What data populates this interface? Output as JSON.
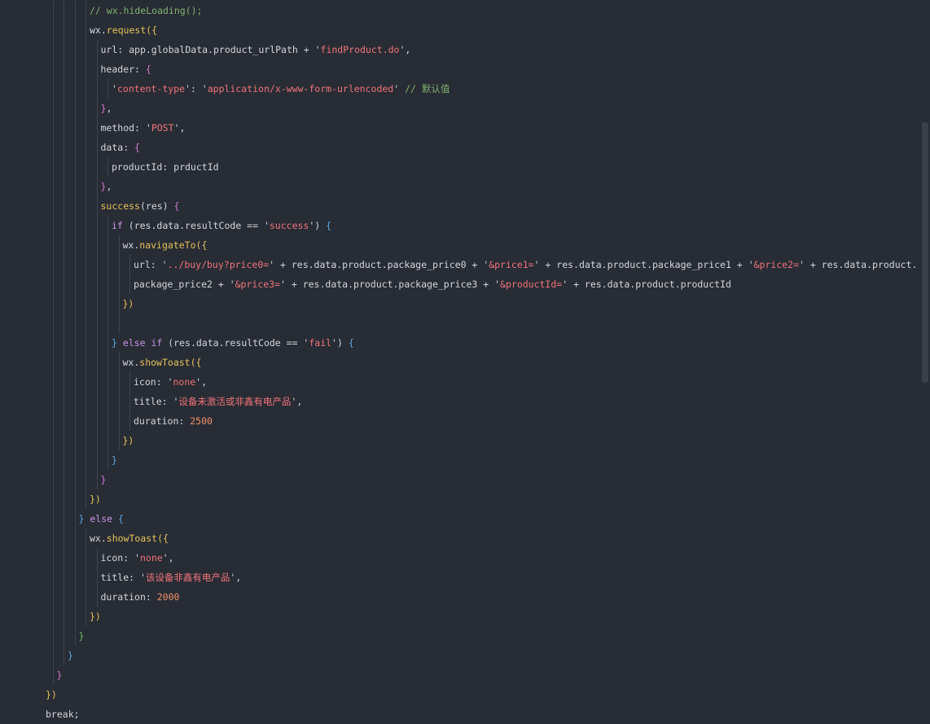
{
  "editor": {
    "language": "javascript",
    "colors": {
      "background": "#282c34",
      "comment": "#7fb36f",
      "string": "#f0737b",
      "number": "#f0916a",
      "function": "#e6c35c",
      "keyword": "#c994e8"
    },
    "lines": [
      {
        "indent": 8,
        "tokens": [
          [
            "// wx.hideLoading();",
            "comment"
          ]
        ]
      },
      {
        "indent": 8,
        "tokens": [
          [
            "wx.",
            "default"
          ],
          [
            "request",
            "fn"
          ],
          [
            "({",
            "bracket-y"
          ]
        ]
      },
      {
        "indent": 10,
        "tokens": [
          [
            "url: app.globalData.product_urlPath + '",
            "default"
          ],
          [
            "findProduct.do",
            "string"
          ],
          [
            "',",
            "default"
          ]
        ]
      },
      {
        "indent": 10,
        "tokens": [
          [
            "header: ",
            "default"
          ],
          [
            "{",
            "bracket-p"
          ]
        ]
      },
      {
        "indent": 12,
        "tokens": [
          [
            "'",
            "default"
          ],
          [
            "content-type",
            "string"
          ],
          [
            "': '",
            "default"
          ],
          [
            "application/x-www-form-urlencoded",
            "string"
          ],
          [
            "' ",
            "default"
          ],
          [
            "// 默认值",
            "comment"
          ]
        ]
      },
      {
        "indent": 10,
        "tokens": [
          [
            "}",
            "bracket-p"
          ],
          [
            ",",
            "default"
          ]
        ]
      },
      {
        "indent": 10,
        "tokens": [
          [
            "method: '",
            "default"
          ],
          [
            "POST",
            "string"
          ],
          [
            "',",
            "default"
          ]
        ]
      },
      {
        "indent": 10,
        "tokens": [
          [
            "data: ",
            "default"
          ],
          [
            "{",
            "bracket-p"
          ]
        ]
      },
      {
        "indent": 12,
        "tokens": [
          [
            "productId: prductId",
            "default"
          ]
        ]
      },
      {
        "indent": 10,
        "tokens": [
          [
            "}",
            "bracket-p"
          ],
          [
            ",",
            "default"
          ]
        ]
      },
      {
        "indent": 10,
        "tokens": [
          [
            "success",
            "fn"
          ],
          [
            "(res) ",
            "default"
          ],
          [
            "{",
            "bracket-p"
          ]
        ]
      },
      {
        "indent": 12,
        "tokens": [
          [
            "if",
            "kw"
          ],
          [
            " (res.data.resultCode == '",
            "default"
          ],
          [
            "success",
            "string"
          ],
          [
            "') ",
            "default"
          ],
          [
            "{",
            "bracket-b"
          ]
        ]
      },
      {
        "indent": 14,
        "tokens": [
          [
            "wx.",
            "default"
          ],
          [
            "navigateTo",
            "fn"
          ],
          [
            "({",
            "bracket-y"
          ]
        ]
      },
      {
        "indent": 16,
        "tokens": [
          [
            "url: '",
            "default"
          ],
          [
            "../buy/buy?price0=",
            "string"
          ],
          [
            "' + res.data.product.package_price0 + '",
            "default"
          ],
          [
            "&price1=",
            "string"
          ],
          [
            "' + res.data.product.package_price1 + '",
            "default"
          ],
          [
            "&price2=",
            "string"
          ],
          [
            "' + res.data.product.",
            "default"
          ]
        ]
      },
      {
        "indent": 16,
        "tokens": [
          [
            "package_price2 + '",
            "default"
          ],
          [
            "&price3=",
            "string"
          ],
          [
            "' + res.data.product.package_price3 + '",
            "default"
          ],
          [
            "&productId=",
            "string"
          ],
          [
            "' + res.data.product.productId",
            "default"
          ]
        ]
      },
      {
        "indent": 14,
        "tokens": [
          [
            "})",
            "bracket-y"
          ]
        ]
      },
      {
        "indent": 14,
        "tokens": []
      },
      {
        "indent": 12,
        "tokens": [
          [
            "} ",
            "bracket-b"
          ],
          [
            "else if",
            "kw"
          ],
          [
            " (res.data.resultCode == '",
            "default"
          ],
          [
            "fail",
            "string"
          ],
          [
            "') ",
            "default"
          ],
          [
            "{",
            "bracket-b"
          ]
        ]
      },
      {
        "indent": 14,
        "tokens": [
          [
            "wx.",
            "default"
          ],
          [
            "showToast",
            "fn"
          ],
          [
            "({",
            "bracket-y"
          ]
        ]
      },
      {
        "indent": 16,
        "tokens": [
          [
            "icon: '",
            "default"
          ],
          [
            "none",
            "string"
          ],
          [
            "',",
            "default"
          ]
        ]
      },
      {
        "indent": 16,
        "tokens": [
          [
            "title: '",
            "default"
          ],
          [
            "设备未激活或非鑫有电产品",
            "string"
          ],
          [
            "',",
            "default"
          ]
        ]
      },
      {
        "indent": 16,
        "tokens": [
          [
            "duration: ",
            "default"
          ],
          [
            "2500",
            "number"
          ]
        ]
      },
      {
        "indent": 14,
        "tokens": [
          [
            "})",
            "bracket-y"
          ]
        ]
      },
      {
        "indent": 12,
        "tokens": [
          [
            "}",
            "bracket-b"
          ]
        ]
      },
      {
        "indent": 10,
        "tokens": [
          [
            "}",
            "bracket-p"
          ]
        ]
      },
      {
        "indent": 8,
        "tokens": [
          [
            "})",
            "bracket-y"
          ]
        ]
      },
      {
        "indent": 6,
        "tokens": [
          [
            "} ",
            "bracket-b"
          ],
          [
            "else",
            "kw"
          ],
          [
            " {",
            "bracket-b"
          ]
        ]
      },
      {
        "indent": 8,
        "tokens": [
          [
            "wx.",
            "default"
          ],
          [
            "showToast",
            "fn"
          ],
          [
            "({",
            "bracket-y"
          ]
        ]
      },
      {
        "indent": 10,
        "tokens": [
          [
            "icon: '",
            "default"
          ],
          [
            "none",
            "string"
          ],
          [
            "',",
            "default"
          ]
        ]
      },
      {
        "indent": 10,
        "tokens": [
          [
            "title: '",
            "default"
          ],
          [
            "该设备非鑫有电产品",
            "string"
          ],
          [
            "',",
            "default"
          ]
        ]
      },
      {
        "indent": 10,
        "tokens": [
          [
            "duration: ",
            "default"
          ],
          [
            "2000",
            "number"
          ]
        ]
      },
      {
        "indent": 8,
        "tokens": [
          [
            "})",
            "bracket-y"
          ]
        ]
      },
      {
        "indent": 6,
        "tokens": [
          [
            "}",
            "bracket-g"
          ]
        ]
      },
      {
        "indent": 4,
        "tokens": [
          [
            "}",
            "bracket-b"
          ]
        ]
      },
      {
        "indent": 2,
        "tokens": [
          [
            "}",
            "bracket-p"
          ]
        ]
      },
      {
        "indent": 0,
        "tokens": [
          [
            "})",
            "bracket-y"
          ]
        ]
      },
      {
        "indent": 0,
        "tokens": [
          [
            "break;",
            "default"
          ]
        ]
      }
    ]
  }
}
